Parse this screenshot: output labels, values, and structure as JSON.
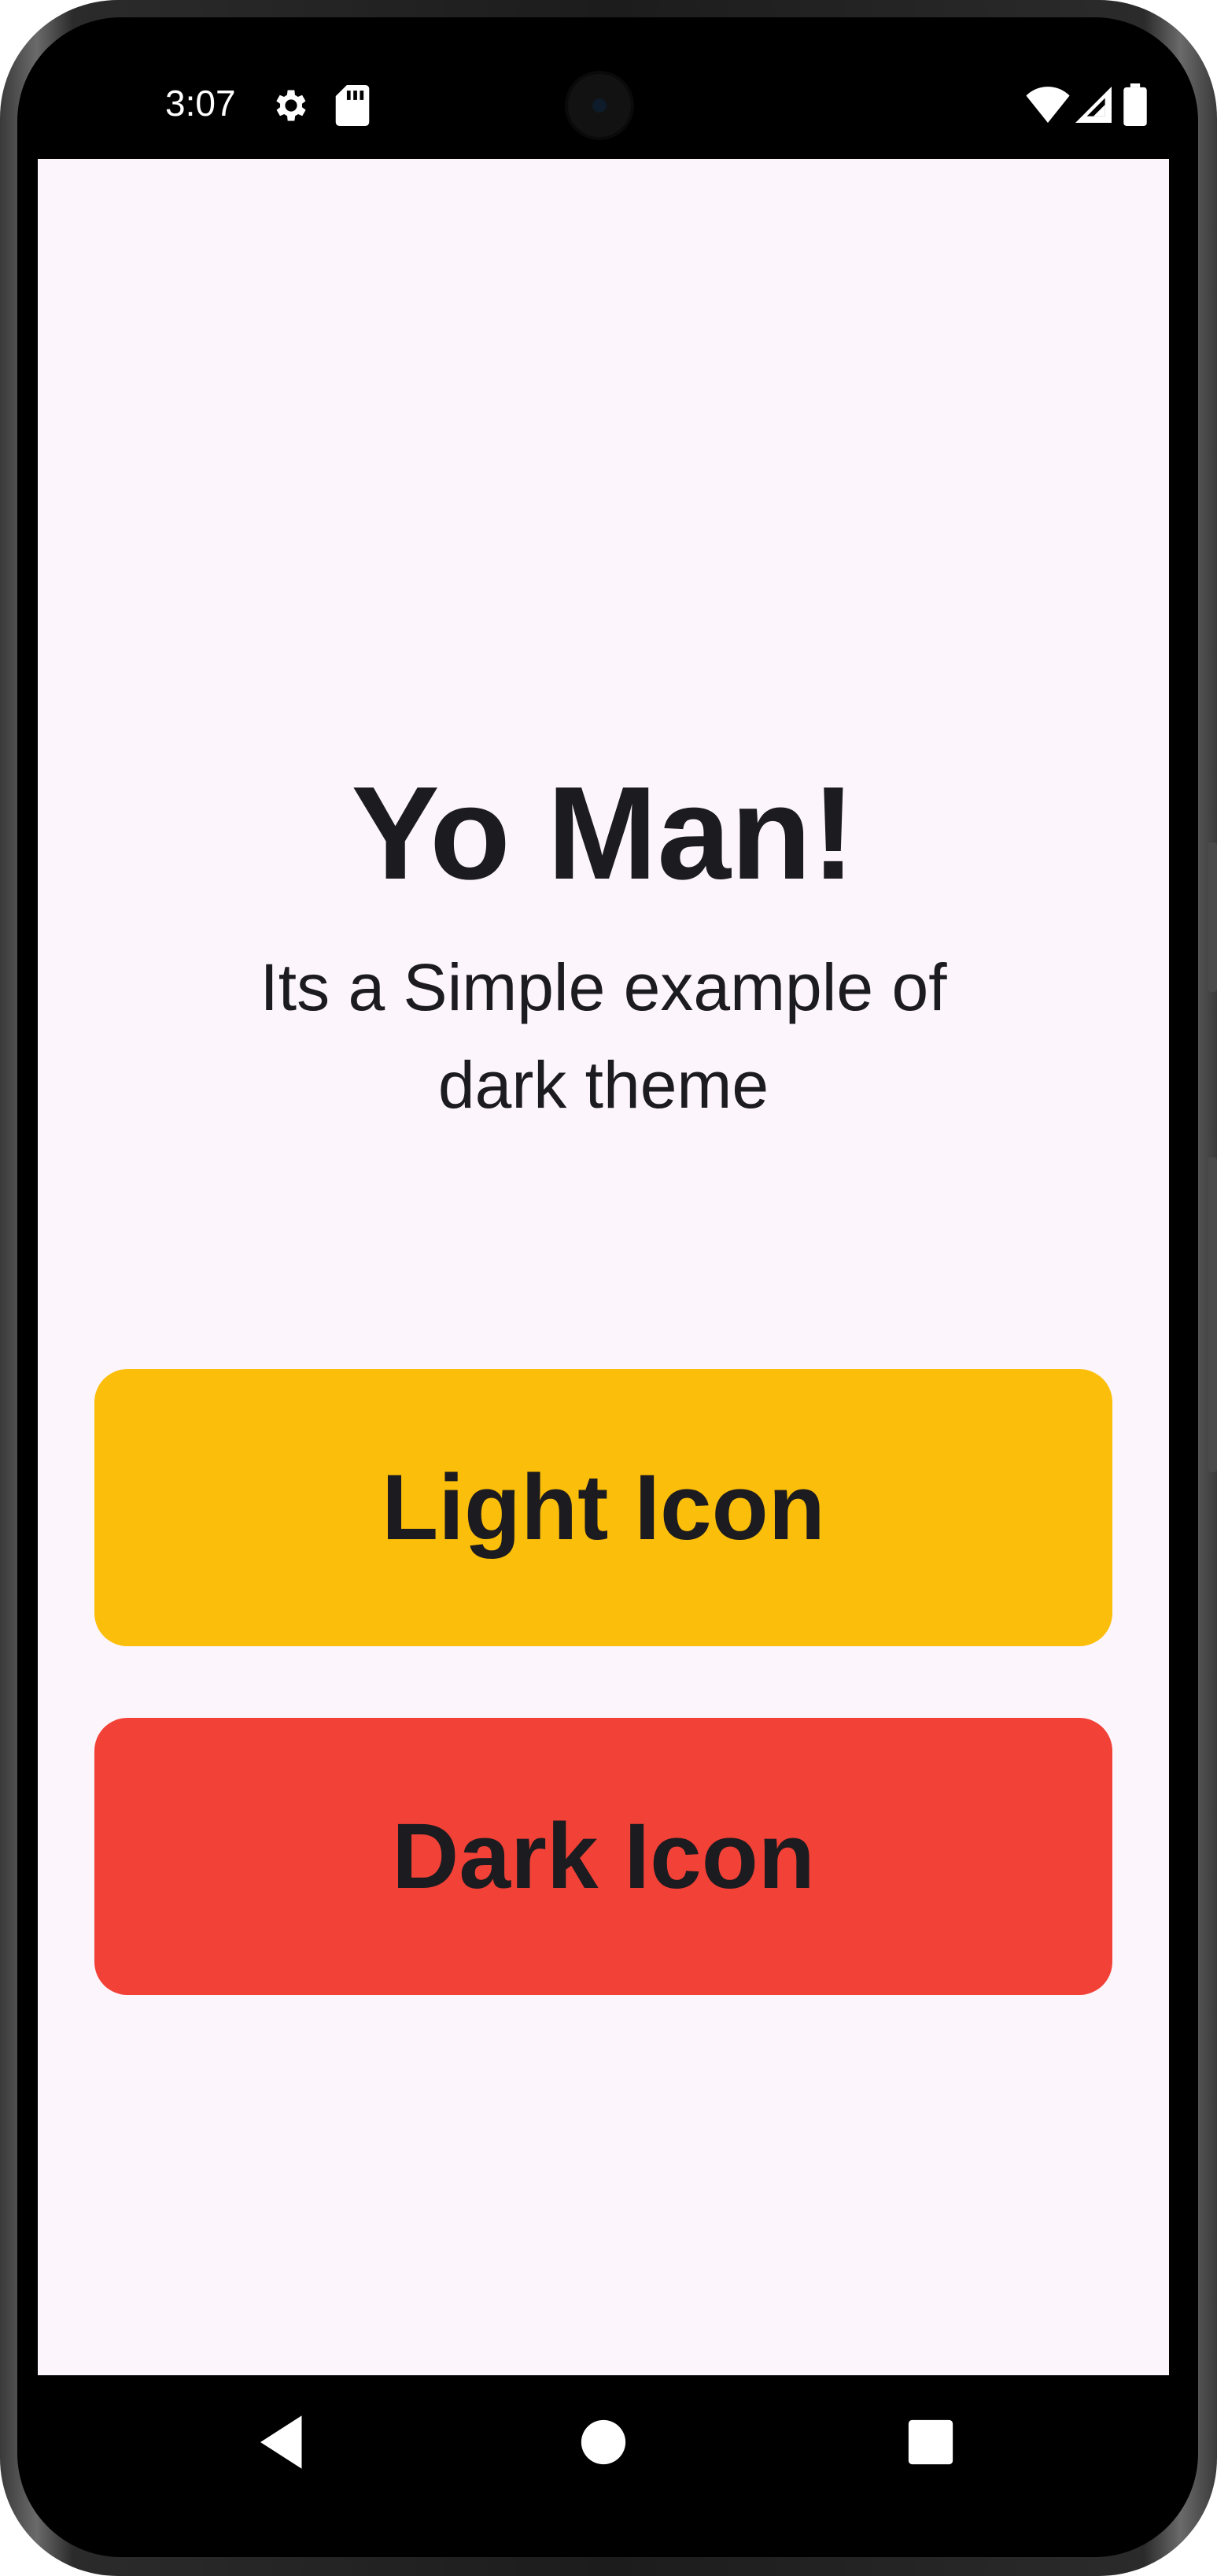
{
  "status_bar": {
    "time": "3:07",
    "icons": [
      "settings-icon",
      "sd-card-icon",
      "wifi-icon",
      "cell-signal-icon",
      "battery-icon"
    ]
  },
  "content": {
    "title": "Yo Man!",
    "subtitle": "Its a Simple example of dark theme"
  },
  "buttons": {
    "light_label": "Light Icon",
    "dark_label": "Dark Icon"
  },
  "navigation": {
    "items": [
      "back-icon",
      "home-icon",
      "recents-icon"
    ]
  },
  "colors": {
    "background": "#fcf5fb",
    "light_button": "#fbbe0a",
    "dark_button": "#f24137",
    "text": "#1c1b1f"
  }
}
